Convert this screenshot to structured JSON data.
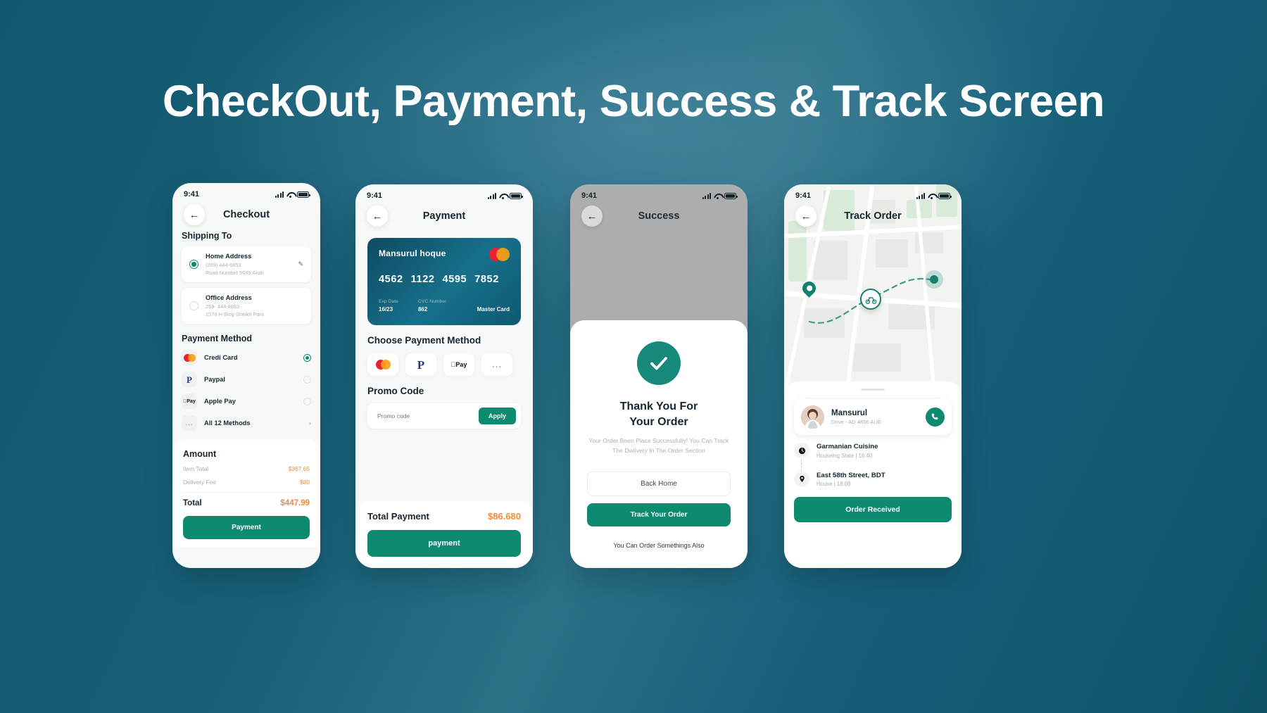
{
  "page": {
    "headline": "CheckOut, Payment, Success & Track Screen"
  },
  "theme": {
    "brand": "#0d8a70",
    "accent_orange": "#f08a3c",
    "bg": "#155a72"
  },
  "status_bar": {
    "time": "9:41"
  },
  "checkout": {
    "title": "Checkout",
    "back_icon": "arrow-left-icon",
    "shipping_title": "Shipping To",
    "addresses": [
      {
        "name": "Home Address",
        "phone": "(269) 444-6853",
        "street": "Road Number 5649 Akali",
        "selected": true,
        "edit_icon": "pencil-icon"
      },
      {
        "name": "Office Address",
        "phone": "259- 444-8853",
        "street": "1578 H Blog Sheikh Para",
        "selected": false
      }
    ],
    "payment_title": "Payment Method",
    "methods": [
      {
        "label": "Credi Card",
        "icon": "mastercard-icon",
        "selected": true
      },
      {
        "label": "Paypal",
        "icon": "paypal-icon",
        "selected": false
      },
      {
        "label": "Apple Pay",
        "icon": "apple-pay-icon",
        "selected": false
      },
      {
        "label": "All 12 Methods",
        "icon": "ellipsis-icon",
        "chevron": "chevron-right-icon"
      }
    ],
    "amount_title": "Amount",
    "amounts": [
      {
        "key": "Item Total",
        "value": "$367.65"
      },
      {
        "key": "Delivery Fee",
        "value": "$80"
      }
    ],
    "total_key": "Total",
    "total_value": "$447.99",
    "cta": "Payment"
  },
  "payment": {
    "title": "Payment",
    "back_icon": "arrow-left-icon",
    "card": {
      "holder": "Mansurul hoque",
      "brand_icon": "mastercard-icon",
      "number_groups": [
        "4562",
        "1122",
        "4595",
        "7852"
      ],
      "exp_label": "Exp Date",
      "exp_value": "16/23",
      "cvc_label": "CVC Number",
      "cvc_value": "862",
      "brand": "Master Card"
    },
    "choose_title": "Choose Payment Method",
    "method_icons": [
      "mastercard-icon",
      "paypal-icon",
      "apple-pay-icon",
      "ellipsis-icon"
    ],
    "promo_title": "Promo Code",
    "promo_placeholder": "Promo code",
    "promo_value": "",
    "apply_label": "Apply",
    "total_key": "Total Payment",
    "total_value": "$86.680",
    "cta": "payment"
  },
  "success": {
    "title": "Success",
    "back_icon": "arrow-left-icon",
    "check_icon": "check-icon",
    "heading_line1": "Thank You For",
    "heading_line2": "Your Order",
    "body": "Your Order Been Place Successfully! You Can Track The Dwlivery In The Order Section",
    "secondary_cta": "Back Home",
    "primary_cta": "Track Your Order",
    "footer": "You Can Order Somethings Also"
  },
  "track": {
    "title": "Track Order",
    "back_icon": "arrow-left-icon",
    "map": {
      "origin_icon": "map-pin-icon",
      "rider_icon": "bicycle-icon",
      "destination_icon": "destination-dot-icon"
    },
    "driver": {
      "name": "Mansurul",
      "vehicle": "Drive - AD 4856 AUE",
      "avatar": "driver-avatar",
      "call_icon": "phone-icon"
    },
    "stops": [
      {
        "name": "Garmanian Cuisine",
        "sub": "Houseing State  |  16:40",
        "icon": "clock-icon"
      },
      {
        "name": "East 58th Street, BDT",
        "sub": "House  |  18:08",
        "icon": "map-pin-icon"
      }
    ],
    "cta": "Order Received"
  }
}
